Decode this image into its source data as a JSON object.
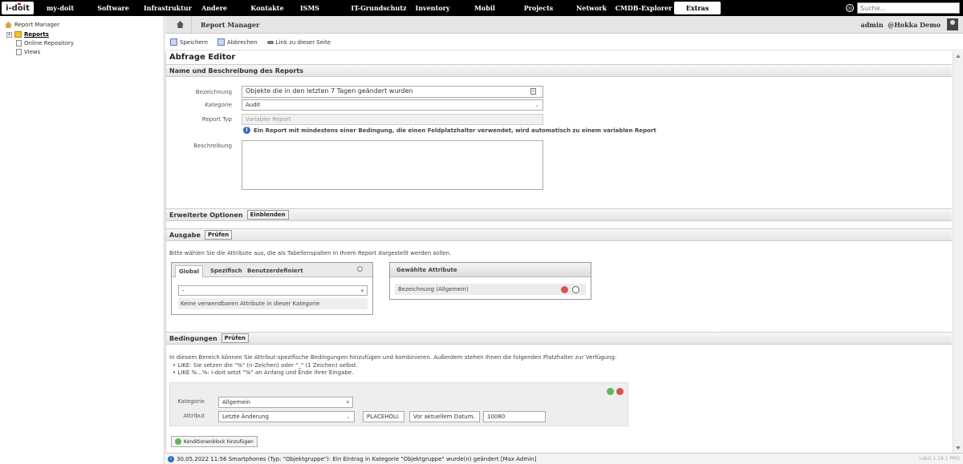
{
  "topnav": {
    "logo": "i-doit",
    "items": [
      "my-doit",
      "Software",
      "Infrastruktur",
      "Andere",
      "Kontakte",
      "ISMS",
      "IT-Grundschutz",
      "Inventory",
      "Mobil",
      "Projects",
      "Network",
      "CMDB-Explorer",
      "Extras"
    ],
    "active": "Extras",
    "search_placeholder": "Suche..."
  },
  "tree": {
    "root": "Report Manager",
    "items": [
      "Reports",
      "Online Repository",
      "Views"
    ]
  },
  "breadcrumb": {
    "current": "Report Manager",
    "user": "admin",
    "tenant": "@Hokka Demo"
  },
  "toolbar": {
    "save": "Speichern",
    "cancel": "Abbrechen",
    "link": "Link zu dieser Seite"
  },
  "editor": {
    "title": "Abfrage Editor",
    "name_section": "Name und Beschreibung des Reports",
    "label_name": "Bezeichnung",
    "value_name": "Objekte die in den letzten 7 Tagen geändert wurden",
    "label_category": "Kategorie",
    "value_category": "Audit",
    "label_type": "Report Typ",
    "value_type": "Variabler Report",
    "info_text": "Ein Report mit mindestens einer Bedingung, die einen Feldplatzhalter verwendet, wird automatisch zu einem variablen Report",
    "label_description": "Beschreibung"
  },
  "advanced": {
    "title": "Erweiterte Optionen",
    "button": "Einblenden"
  },
  "output": {
    "title": "Ausgabe",
    "check": "Prüfen",
    "instruction": "Bitte wählen Sie die Attribute aus, die als Tabellenspalten in Ihrem Report dargestellt werden sollen.",
    "tabs": [
      "Global",
      "Spezifisch",
      "Benutzerdefiniert"
    ],
    "select_value": "-",
    "empty_text": "Keine verwendbaren Attribute in dieser Kategorie",
    "selected_head": "Gewählte Attribute",
    "selected_item": "Bezeichnung (Allgemein)"
  },
  "conditions": {
    "title": "Bedingungen",
    "check": "Prüfen",
    "intro": "In diesem Bereich können Sie Attribut-spezifische Bedingungen hinzufügen und kombinieren. Außerdem stehen Ihnen die folgenden Platzhalter zur Verfügung:",
    "bullet1": "• LIKE: Sie setzen die \"%\" (n-Zeichen) oder \"_\" (1 Zeichen) selbst.",
    "bullet2": "• LIKE %...%: i-doit setzt \"%\" an Anfang und Ende ihrer Eingabe.",
    "label_category": "Kategorie",
    "value_category": "Allgemein",
    "label_attribute": "Attribut",
    "value_attribute": "Letzte Änderung",
    "value_operator": "PLACEHOLI",
    "value_relation": "Vor aktuellem Datum",
    "value_input": "10080",
    "add_block": "Konditionenblock hinzufügen"
  },
  "status": {
    "message": "30.05.2022 11:56 Smartphones (Typ: \"Objektgruppe\"): Ein Eintrag in Kategorie \"Objektgruppe\" wurde(n) geändert [Max Admin]",
    "version": "i-doit 1.18.1 PRO"
  }
}
